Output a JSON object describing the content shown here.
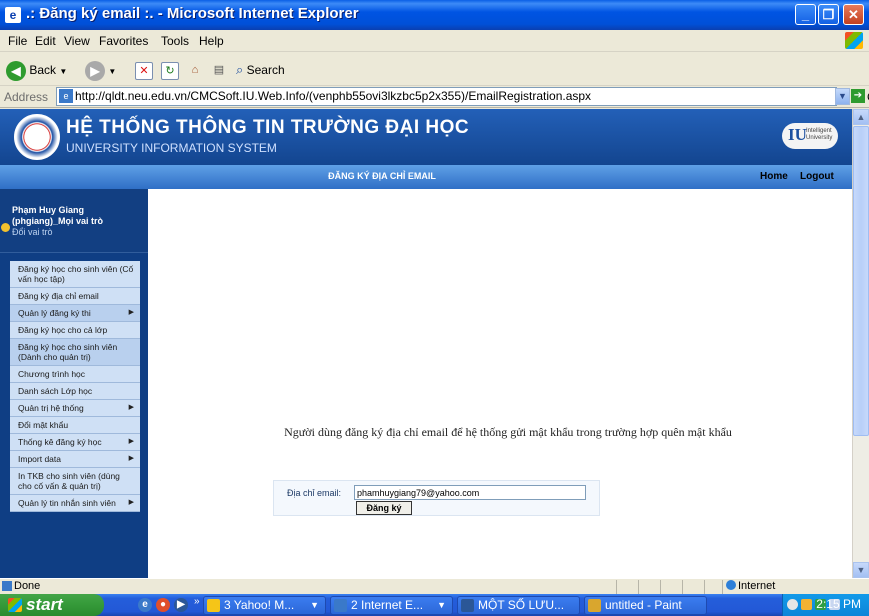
{
  "window": {
    "title": ".: Đăng ký email :. - Microsoft Internet Explorer"
  },
  "menubar": {
    "items": [
      "File",
      "Edit",
      "View",
      "Favorites",
      "Tools",
      "Help"
    ]
  },
  "toolbar": {
    "back_label": "Back",
    "search_label": "Search"
  },
  "addressbar": {
    "label": "Address",
    "url": "http://qldt.neu.edu.vn/CMCSoft.IU.Web.Info/(venphb55ovi3lkzbc5p2x355)/EmailRegistration.aspx",
    "go_label": "Go"
  },
  "page": {
    "header": {
      "title": "HỆ THỐNG THÔNG TIN TRƯỜNG ĐẠI HỌC",
      "subtitle": "UNIVERSITY INFORMATION SYSTEM",
      "logo_letters": "IU",
      "logo_text": "Intelligent University"
    },
    "nav": {
      "page_title": "ĐĂNG KÝ ĐỊA CHỈ EMAIL",
      "home": "Home",
      "logout": "Logout"
    },
    "user": {
      "name": "Phạm Huy Giang (phgiang)_Mọi vai trò",
      "change_role": "Đổi vai trò"
    },
    "menu": [
      {
        "label": "Đăng ký học cho sinh viên (Cố vấn học tập)",
        "arrow": ""
      },
      {
        "label": "Đăng ký địa chỉ email",
        "arrow": ""
      },
      {
        "label": "Quản lý đăng ký thi",
        "arrow": "▶"
      },
      {
        "label": "Đăng ký học cho cả lớp",
        "arrow": ""
      },
      {
        "label": "Đăng ký học cho sinh viên (Dành cho quản trị)",
        "arrow": ""
      },
      {
        "label": "Chương trình học",
        "arrow": ""
      },
      {
        "label": "Danh sách Lớp học",
        "arrow": ""
      },
      {
        "label": "Quản trị hệ thống",
        "arrow": "▶"
      },
      {
        "label": "Đổi mật khẩu",
        "arrow": ""
      },
      {
        "label": "Thống kê đăng ký học",
        "arrow": "▶"
      },
      {
        "label": "Import data",
        "arrow": "▶"
      },
      {
        "label": "In TKB cho sinh viên (dùng cho cố vấn & quản trị)",
        "arrow": ""
      },
      {
        "label": "Quản lý tin nhắn sinh viên",
        "arrow": "▶"
      }
    ],
    "notice": "Người dùng đăng ký địa chỉ email để hệ thống gửi mật khẩu trong trường hợp quên mật khẩu",
    "form": {
      "email_label": "Địa chỉ email:",
      "email_value": "phamhuygiang79@yahoo.com",
      "submit_label": "Đăng ký"
    }
  },
  "statusbar": {
    "status": "Done",
    "zone": "Internet"
  },
  "taskbar": {
    "start_label": "start",
    "tasks": [
      {
        "label": "3 Yahoo! M...",
        "icon_color": "#f5c518",
        "arrow": "▼"
      },
      {
        "label": "2 Internet E...",
        "icon_color": "#3a79c9",
        "arrow": "▼"
      },
      {
        "label": "MỘT SỐ LƯU...",
        "icon_color": "#2b5797",
        "arrow": ""
      },
      {
        "label": "untitled - Paint",
        "icon_color": "#d9a62e",
        "arrow": ""
      }
    ],
    "clock": "2:15 PM"
  },
  "colors": {
    "xp_title_blue": "#0054e3",
    "header_blue": "#13458f",
    "menu_item_bg": "#cfe0f5",
    "start_green": "#379c3b"
  }
}
